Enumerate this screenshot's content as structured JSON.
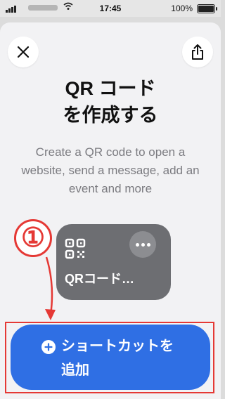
{
  "status_bar": {
    "time": "17:45",
    "battery_text": "100%",
    "battery_level": 1.0
  },
  "sheet": {
    "title_line1": "QR コード",
    "title_line2": "を作成する",
    "description": "Create a QR code to open a website, send a message, add an event and more",
    "tile_label": "QRコード…",
    "add_button_line1": "ショートカットを",
    "add_button_line2": "追加"
  },
  "annotation": {
    "step_number": "①",
    "color": "#e53935"
  },
  "colors": {
    "accent": "#2f6fe4",
    "sheet_bg": "#f2f2f4",
    "tile_bg": "#6d6e72"
  },
  "icons": [
    "close-icon",
    "share-icon",
    "qr-code-icon",
    "more-icon",
    "plus-icon"
  ]
}
